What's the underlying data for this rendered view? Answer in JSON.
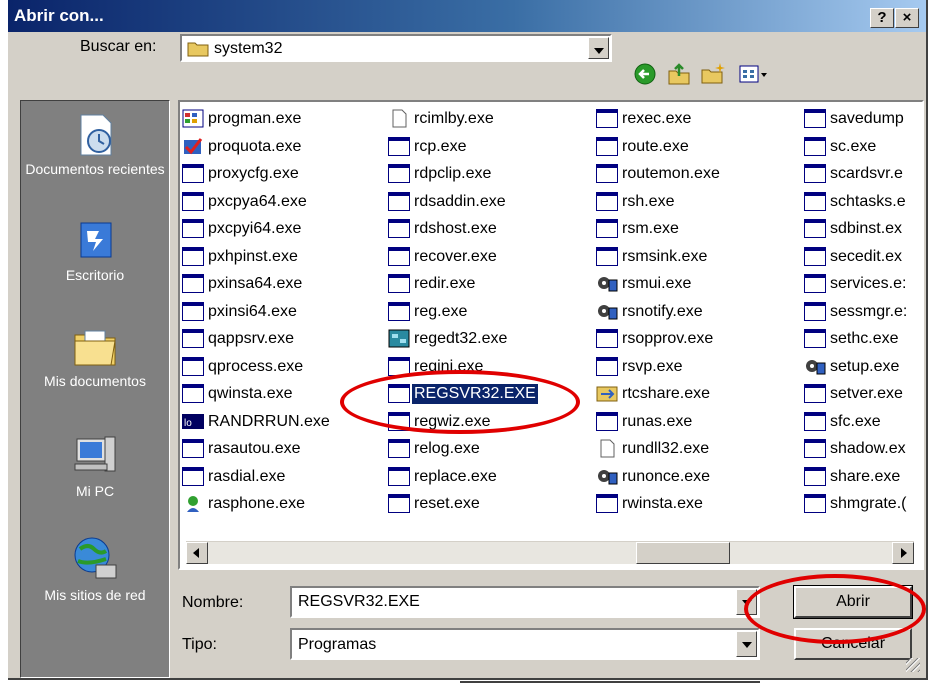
{
  "window": {
    "title": "Abrir con...",
    "help_glyph": "?",
    "close_glyph": "×"
  },
  "lookin": {
    "label": "Buscar en:",
    "value": "system32"
  },
  "places": [
    {
      "label": "Documentos recientes",
      "icon": "recent-documents-icon"
    },
    {
      "label": "Escritorio",
      "icon": "desktop-icon"
    },
    {
      "label": "Mis documentos",
      "icon": "my-documents-icon"
    },
    {
      "label": "Mi PC",
      "icon": "my-computer-icon"
    },
    {
      "label": "Mis sitios de red",
      "icon": "network-places-icon"
    }
  ],
  "files": {
    "columns": [
      [
        "progman.exe",
        "proquota.exe",
        "proxycfg.exe",
        "pxcpya64.exe",
        "pxcpyi64.exe",
        "pxhpinst.exe",
        "pxinsa64.exe",
        "pxinsi64.exe",
        "qappsrv.exe",
        "qprocess.exe",
        "qwinsta.exe",
        "RANDRRUN.exe",
        "rasautou.exe",
        "rasdial.exe",
        "rasphone.exe"
      ],
      [
        "rcimlby.exe",
        "rcp.exe",
        "rdpclip.exe",
        "rdsaddin.exe",
        "rdshost.exe",
        "recover.exe",
        "redir.exe",
        "reg.exe",
        "regedt32.exe",
        "regini.exe",
        "REGSVR32.EXE",
        "regwiz.exe",
        "relog.exe",
        "replace.exe",
        "reset.exe"
      ],
      [
        "rexec.exe",
        "route.exe",
        "routemon.exe",
        "rsh.exe",
        "rsm.exe",
        "rsmsink.exe",
        "rsmui.exe",
        "rsnotify.exe",
        "rsopprov.exe",
        "rsvp.exe",
        "rtcshare.exe",
        "runas.exe",
        "rundll32.exe",
        "runonce.exe",
        "rwinsta.exe"
      ],
      [
        "savedump",
        "sc.exe",
        "scardsvr.e",
        "schtasks.e",
        "sdbinst.ex",
        "secedit.ex",
        "services.e:",
        "sessmgr.e:",
        "sethc.exe",
        "setup.exe",
        "setver.exe",
        "sfc.exe",
        "shadow.ex",
        "share.exe",
        "shmgrate.("
      ]
    ],
    "selected": "REGSVR32.EXE"
  },
  "filename": {
    "label": "Nombre:",
    "value": "REGSVR32.EXE"
  },
  "filetype": {
    "label": "Tipo:",
    "value": "Programas"
  },
  "buttons": {
    "open": "Abrir",
    "cancel": "Cancelar"
  },
  "colors": {
    "annotation": "#e00000",
    "selection": "#0a246a",
    "title_start": "#0a246a"
  }
}
